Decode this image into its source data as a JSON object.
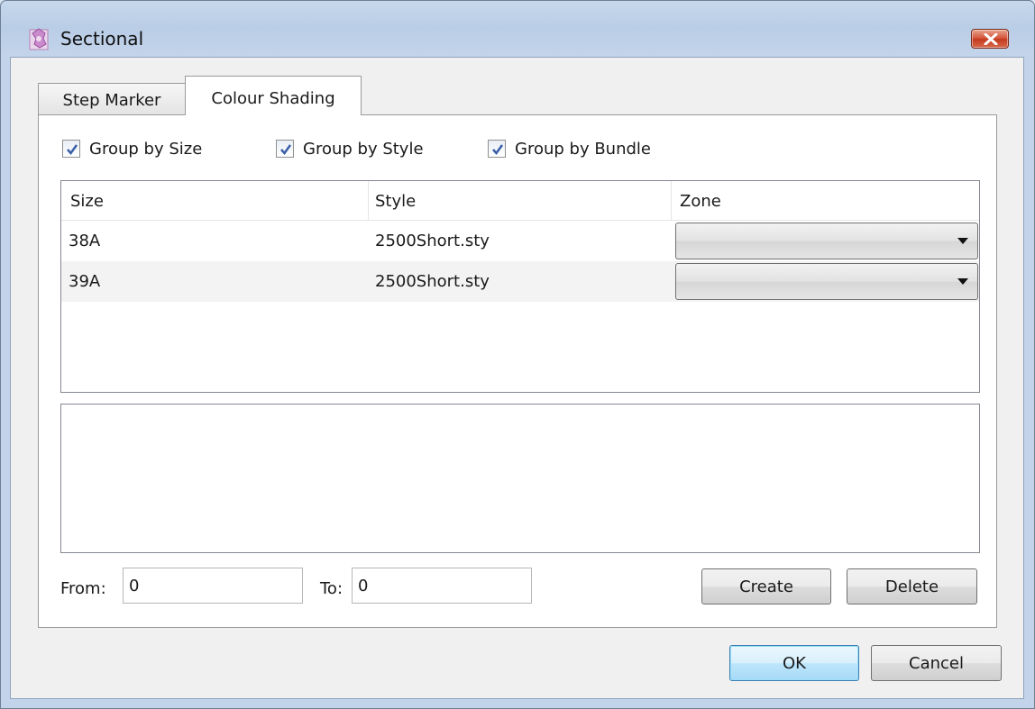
{
  "window": {
    "title": "Sectional"
  },
  "tabs": [
    {
      "label": "Step Marker",
      "selected": false
    },
    {
      "label": "Colour Shading",
      "selected": true
    }
  ],
  "options": {
    "group_by_size": {
      "label": "Group by Size",
      "checked": true
    },
    "group_by_style": {
      "label": "Group by Style",
      "checked": true
    },
    "group_by_bundle": {
      "label": "Group by Bundle",
      "checked": true
    }
  },
  "table": {
    "columns": [
      "Size",
      "Style",
      "Zone"
    ],
    "rows": [
      {
        "size": "38A",
        "style": "2500Short.sty",
        "zone": ""
      },
      {
        "size": "39A",
        "style": "2500Short.sty",
        "zone": ""
      }
    ]
  },
  "range": {
    "from_label": "From:",
    "from_value": "0",
    "to_label": "To:",
    "to_value": "0"
  },
  "buttons": {
    "create": "Create",
    "delete": "Delete",
    "ok": "OK",
    "cancel": "Cancel"
  },
  "icons": {
    "app": "app-icon",
    "close": "close-icon",
    "check": "checkmark-icon",
    "dropdown": "chevron-down-icon"
  },
  "colors": {
    "close_button": "#d5533a",
    "default_button": "#bee6fd"
  }
}
